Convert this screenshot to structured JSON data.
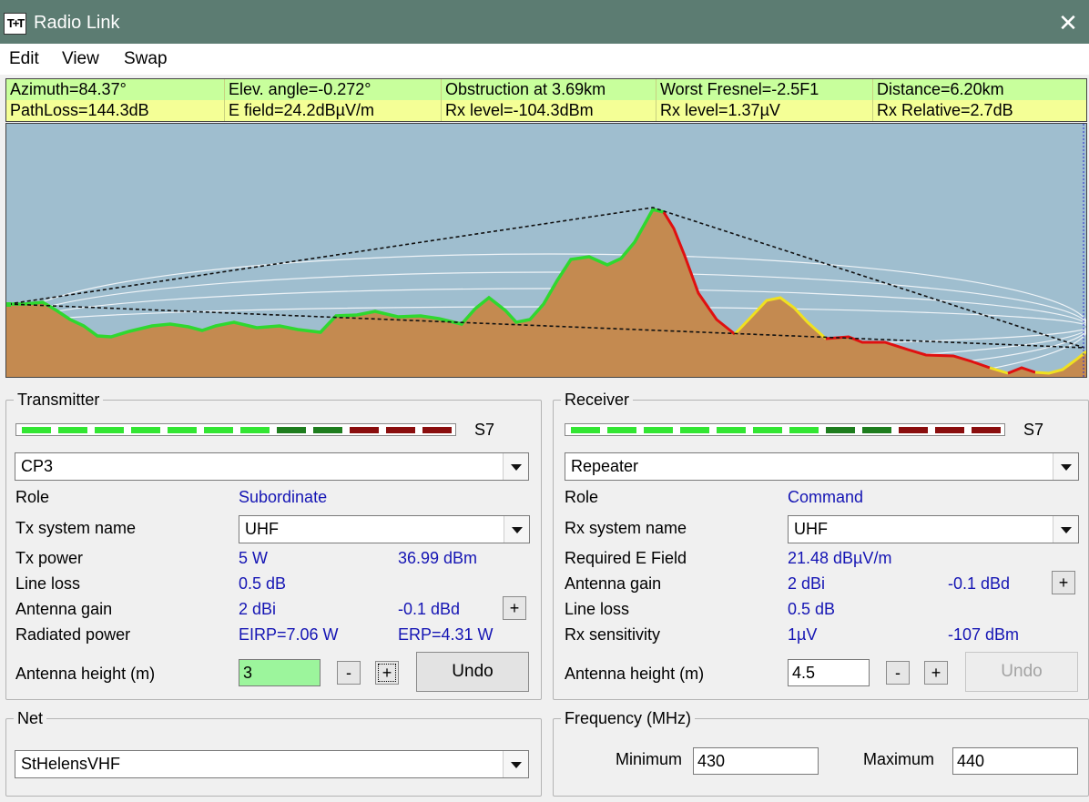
{
  "window": {
    "title": "Radio Link",
    "app_icon_text": "T+T",
    "close_glyph": "✕"
  },
  "menu": [
    "Edit",
    "View",
    "Swap"
  ],
  "info_rows": [
    [
      "Azimuth=84.37°",
      "Elev. angle=-0.272°",
      "Obstruction at 3.69km",
      "Worst Fresnel=-2.5F1",
      "Distance=6.20km"
    ],
    [
      "PathLoss=144.3dB",
      "E field=24.2dBµV/m",
      "Rx level=-104.3dBm",
      "Rx level=1.37µV",
      "Rx Relative=2.7dB"
    ]
  ],
  "colors": {
    "sky": "#9fbecf",
    "terrain": "#c48a50",
    "los_clear": "#2fd82f",
    "obstructed": "#e01010",
    "marginal": "#f0e020",
    "meter_green": "#33e633",
    "meter_dark_green": "#1e7d1e",
    "meter_dark_red": "#8a0e0e",
    "value_blue": "#1515b4"
  },
  "transmitter": {
    "group_label": "Transmitter",
    "meter_label": "S7",
    "meter_segments": [
      "green",
      "green",
      "green",
      "green",
      "green",
      "green",
      "green",
      "dark_green",
      "dark_green",
      "dark_red",
      "dark_red",
      "dark_red"
    ],
    "site": "CP3",
    "role_label": "Role",
    "role_value": "Subordinate",
    "sys_label": "Tx system name",
    "sys_value": "UHF",
    "power_label": "Tx power",
    "power_w": "5 W",
    "power_dbm": "36.99 dBm",
    "line_loss_label": "Line loss",
    "line_loss_value": "0.5 dB",
    "gain_label": "Antenna gain",
    "gain_dbi": "2 dBi",
    "gain_dbd": "-0.1 dBd",
    "radiated_label": "Radiated power",
    "eirp": "EIRP=7.06 W",
    "erp": "ERP=4.31 W",
    "height_label": "Antenna height (m)",
    "height_value": "3",
    "minus": "-",
    "plus": "+",
    "gain_plus": "+",
    "undo": "Undo"
  },
  "receiver": {
    "group_label": "Receiver",
    "meter_label": "S7",
    "meter_segments": [
      "green",
      "green",
      "green",
      "green",
      "green",
      "green",
      "green",
      "dark_green",
      "dark_green",
      "dark_red",
      "dark_red",
      "dark_red"
    ],
    "site": "Repeater",
    "role_label": "Role",
    "role_value": "Command",
    "sys_label": "Rx system name",
    "sys_value": "UHF",
    "req_label": "Required E Field",
    "req_value": "21.48 dBµV/m",
    "gain_label": "Antenna gain",
    "gain_dbi": "2 dBi",
    "gain_dbd": "-0.1 dBd",
    "line_loss_label": "Line loss",
    "line_loss_value": "0.5 dB",
    "sens_label": "Rx sensitivity",
    "sens_uv": "1µV",
    "sens_dbm": "-107 dBm",
    "height_label": "Antenna height (m)",
    "height_value": "4.5",
    "minus": "-",
    "plus": "+",
    "gain_plus": "+",
    "undo": "Undo"
  },
  "net": {
    "group_label": "Net",
    "value": "StHelensVHF"
  },
  "frequency": {
    "group_label": "Frequency (MHz)",
    "min_label": "Minimum",
    "min_value": "430",
    "max_label": "Maximum",
    "max_value": "440"
  }
}
